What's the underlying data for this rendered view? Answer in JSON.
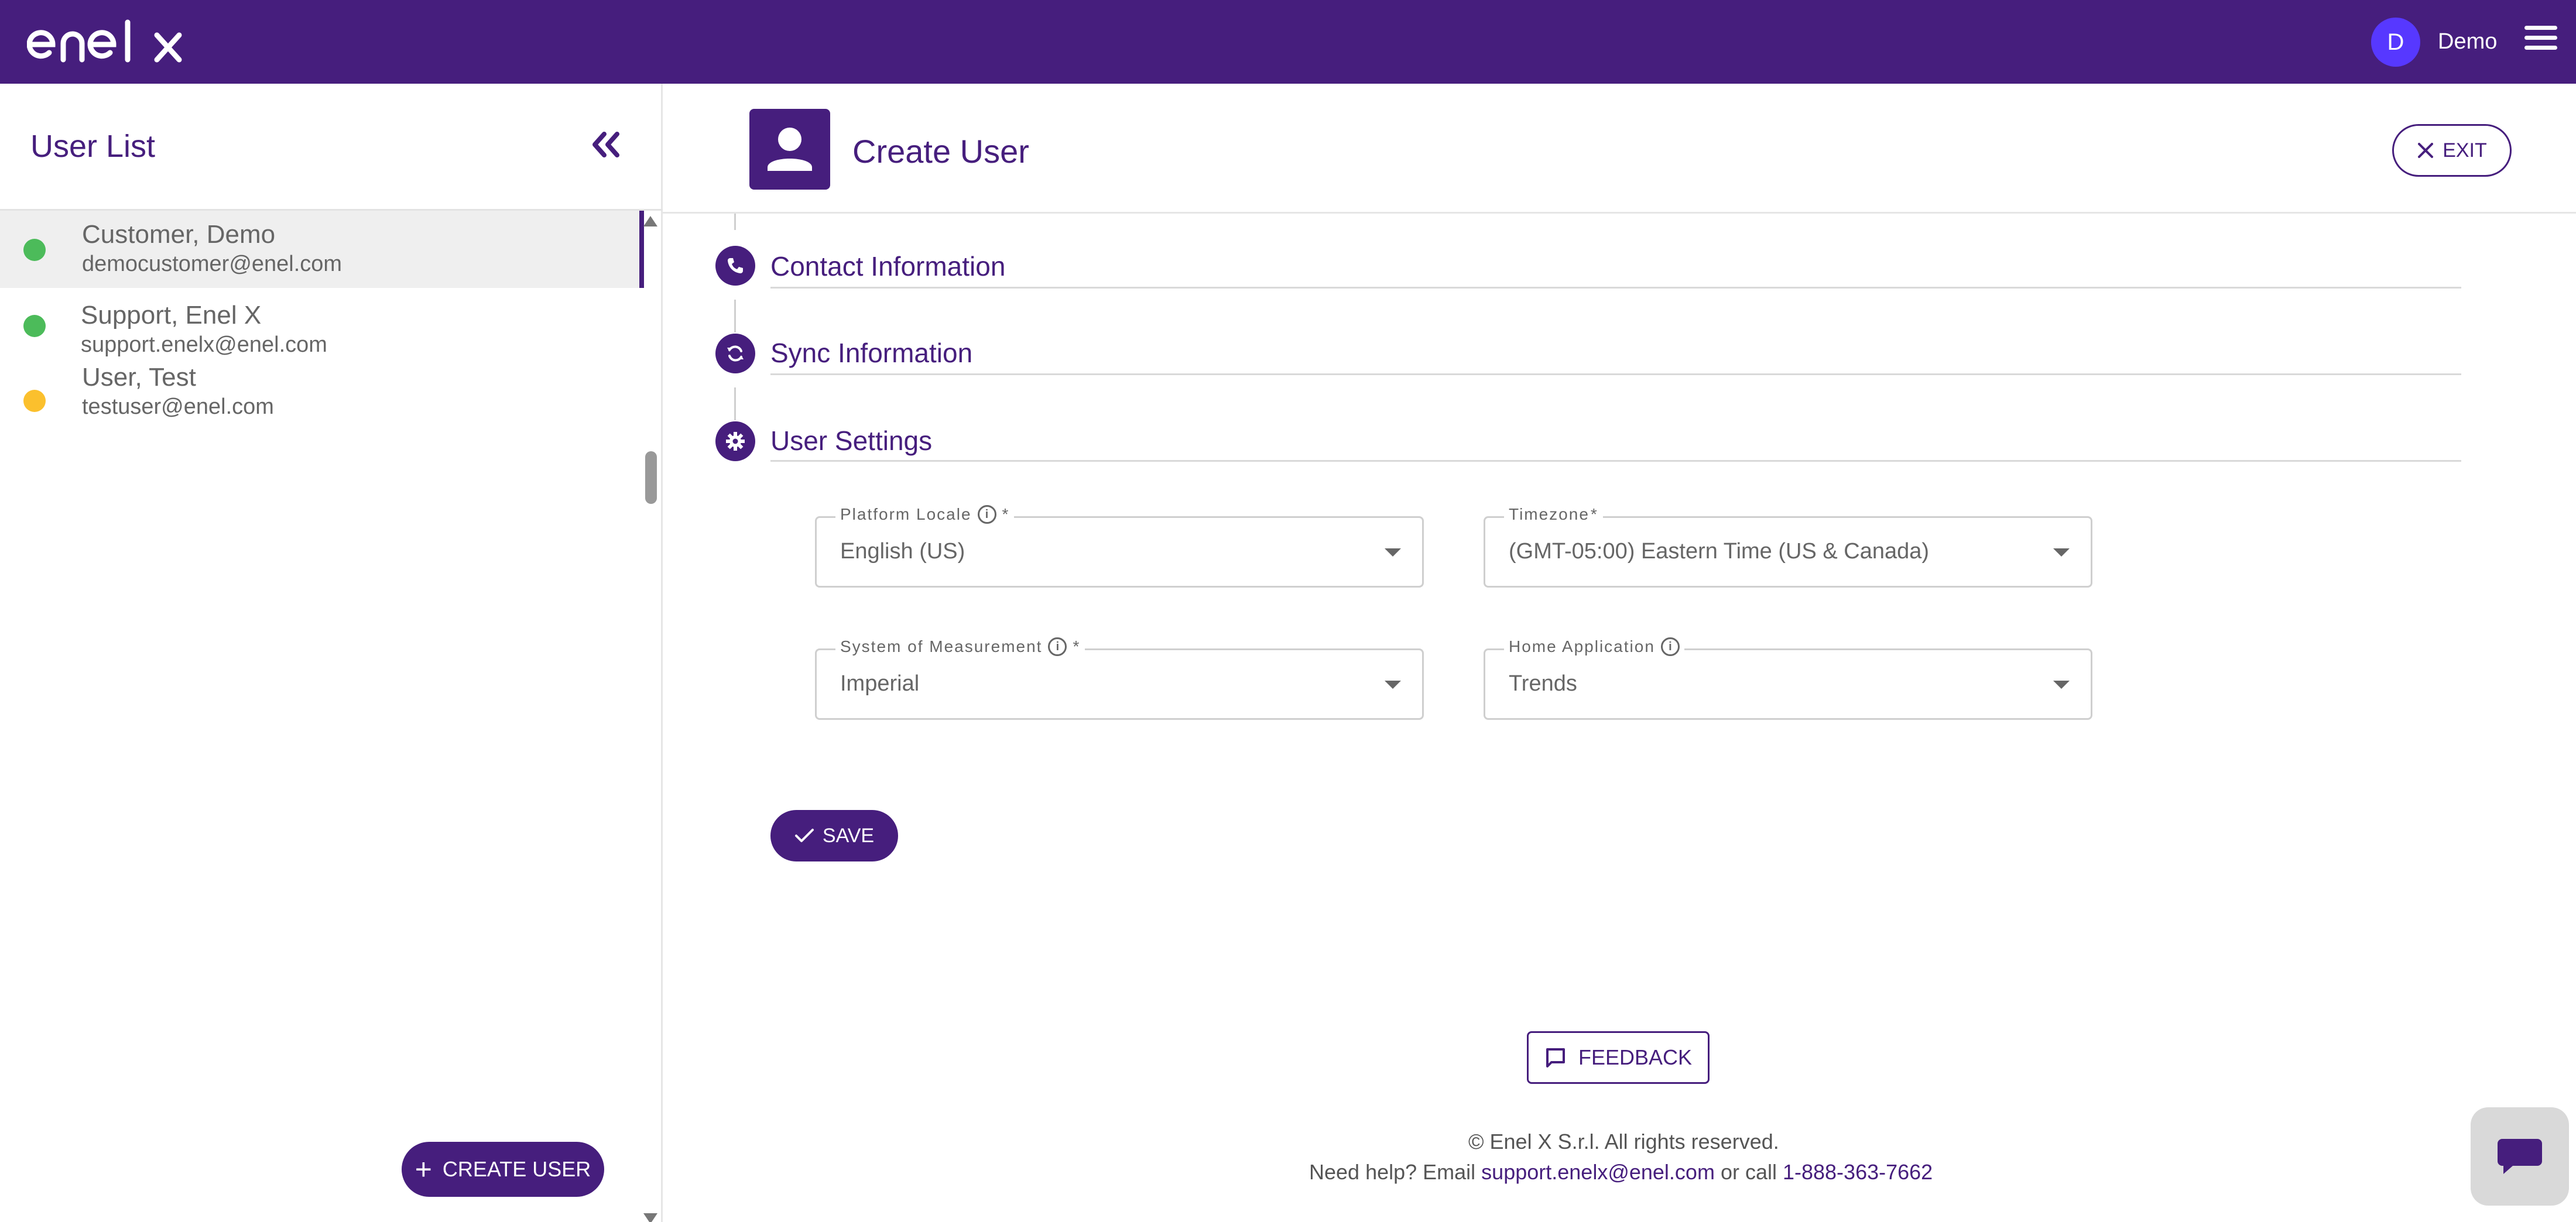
{
  "brand": {
    "logo_text": "enel x",
    "primary_color": "#461e7d",
    "avatar_color": "#5738ff"
  },
  "header": {
    "avatar_initial": "D",
    "user_name": "Demo",
    "menu_icon": "hamburger-menu-icon"
  },
  "user_list": {
    "title": "User List",
    "collapse_icon": "double-chevron-left-icon",
    "users": [
      {
        "name": "Customer, Demo",
        "email": "democustomer@enel.com",
        "status_color": "#4cbb5a",
        "selected": true
      },
      {
        "name": "Support, Enel X",
        "email": "support.enelx@enel.com",
        "status_color": "#4cbb5a",
        "selected": false
      },
      {
        "name": "User, Test",
        "email": "testuser@enel.com",
        "status_color": "#fbc02d",
        "selected": false
      }
    ],
    "create_button": "CREATE USER"
  },
  "main": {
    "title": "Create User",
    "title_icon": "person-icon",
    "exit_button": "EXIT",
    "sections": [
      {
        "title": "Contact Information",
        "icon": "phone-icon"
      },
      {
        "title": "Sync Information",
        "icon": "sync-icon"
      },
      {
        "title": "User Settings",
        "icon": "gear-icon"
      }
    ],
    "fields": {
      "platform_locale": {
        "label": "Platform Locale",
        "required": "*",
        "value": "English (US)"
      },
      "timezone": {
        "label": "Timezone",
        "required": "*",
        "value": "(GMT-05:00) Eastern Time (US & Canada)"
      },
      "system_of_measurement": {
        "label": "System of Measurement",
        "required": "*",
        "value": "Imperial"
      },
      "home_application": {
        "label": "Home Application",
        "value": "Trends"
      }
    },
    "save_button": "SAVE"
  },
  "footer": {
    "feedback_button": "FEEDBACK",
    "copyright": "© Enel X S.r.l. All rights reserved.",
    "help_prefix": "Need help? Email ",
    "help_email": "support.enelx@enel.com",
    "help_middle": " or call ",
    "help_phone": "1-888-363-7662"
  }
}
